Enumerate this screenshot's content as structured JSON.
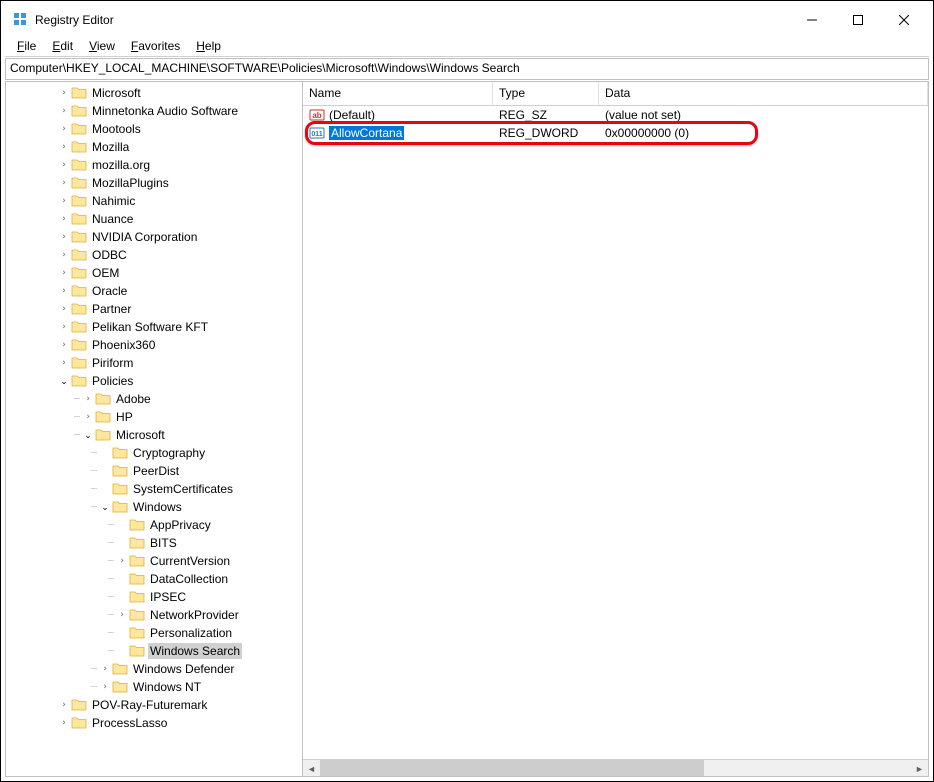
{
  "window": {
    "title": "Registry Editor"
  },
  "menu": {
    "file": "File",
    "edit": "Edit",
    "view": "View",
    "favorites": "Favorites",
    "help": "Help"
  },
  "address": "Computer\\HKEY_LOCAL_MACHINE\\SOFTWARE\\Policies\\Microsoft\\Windows\\Windows Search",
  "columns": {
    "name": "Name",
    "type": "Type",
    "data": "Data"
  },
  "values": [
    {
      "name": "(Default)",
      "type": "REG_SZ",
      "data": "(value not set)",
      "icon": "string",
      "selected": false
    },
    {
      "name": "AllowCortana",
      "type": "REG_DWORD",
      "data": "0x00000000 (0)",
      "icon": "dword",
      "selected": true
    }
  ],
  "tree": [
    {
      "indent": 3,
      "expander": ">",
      "label": "Microsoft"
    },
    {
      "indent": 3,
      "expander": ">",
      "label": "Minnetonka Audio Software"
    },
    {
      "indent": 3,
      "expander": ">",
      "label": "Mootools"
    },
    {
      "indent": 3,
      "expander": ">",
      "label": "Mozilla"
    },
    {
      "indent": 3,
      "expander": ">",
      "label": "mozilla.org"
    },
    {
      "indent": 3,
      "expander": ">",
      "label": "MozillaPlugins"
    },
    {
      "indent": 3,
      "expander": ">",
      "label": "Nahimic"
    },
    {
      "indent": 3,
      "expander": ">",
      "label": "Nuance"
    },
    {
      "indent": 3,
      "expander": ">",
      "label": "NVIDIA Corporation"
    },
    {
      "indent": 3,
      "expander": ">",
      "label": "ODBC"
    },
    {
      "indent": 3,
      "expander": ">",
      "label": "OEM"
    },
    {
      "indent": 3,
      "expander": ">",
      "label": "Oracle"
    },
    {
      "indent": 3,
      "expander": ">",
      "label": "Partner"
    },
    {
      "indent": 3,
      "expander": ">",
      "label": "Pelikan Software KFT"
    },
    {
      "indent": 3,
      "expander": ">",
      "label": "Phoenix360"
    },
    {
      "indent": 3,
      "expander": ">",
      "label": "Piriform"
    },
    {
      "indent": 3,
      "expander": "v",
      "label": "Policies"
    },
    {
      "indent": 4,
      "expander": ">",
      "label": "Adobe",
      "dots": true
    },
    {
      "indent": 4,
      "expander": ">",
      "label": "HP",
      "dots": true
    },
    {
      "indent": 4,
      "expander": "v",
      "label": "Microsoft",
      "dots": true
    },
    {
      "indent": 5,
      "expander": "",
      "label": "Cryptography",
      "dots": true
    },
    {
      "indent": 5,
      "expander": "",
      "label": "PeerDist",
      "dots": true
    },
    {
      "indent": 5,
      "expander": "",
      "label": "SystemCertificates",
      "dots": true
    },
    {
      "indent": 5,
      "expander": "v",
      "label": "Windows",
      "dots": true
    },
    {
      "indent": 6,
      "expander": "",
      "label": "AppPrivacy",
      "dots": true
    },
    {
      "indent": 6,
      "expander": "",
      "label": "BITS",
      "dots": true
    },
    {
      "indent": 6,
      "expander": ">",
      "label": "CurrentVersion",
      "dots": true
    },
    {
      "indent": 6,
      "expander": "",
      "label": "DataCollection",
      "dots": true
    },
    {
      "indent": 6,
      "expander": "",
      "label": "IPSEC",
      "dots": true
    },
    {
      "indent": 6,
      "expander": ">",
      "label": "NetworkProvider",
      "dots": true
    },
    {
      "indent": 6,
      "expander": "",
      "label": "Personalization",
      "dots": true
    },
    {
      "indent": 6,
      "expander": "",
      "label": "Windows Search",
      "dots": true,
      "selected": true
    },
    {
      "indent": 5,
      "expander": ">",
      "label": "Windows Defender",
      "dots": true
    },
    {
      "indent": 5,
      "expander": ">",
      "label": "Windows NT",
      "dots": true
    },
    {
      "indent": 3,
      "expander": ">",
      "label": "POV-Ray-Futuremark"
    },
    {
      "indent": 3,
      "expander": ">",
      "label": "ProcessLasso"
    }
  ]
}
